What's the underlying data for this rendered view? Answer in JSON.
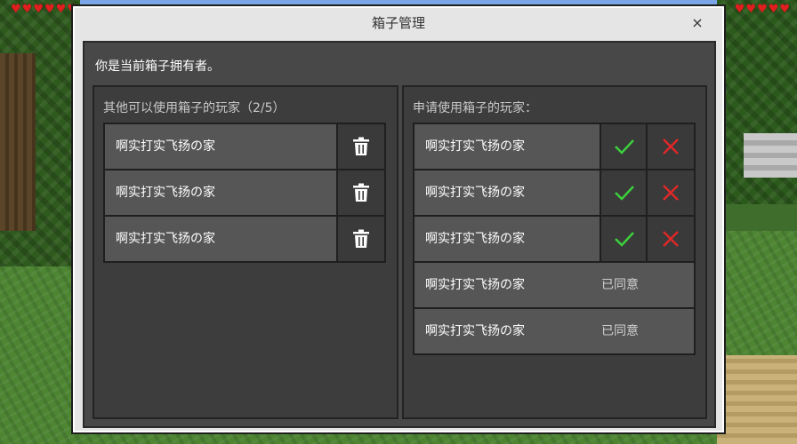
{
  "dialog": {
    "title": "箱子管理",
    "close_label": "×",
    "owner_text": "你是当前箱子拥有者。"
  },
  "left_panel": {
    "title": "其他可以使用箱子的玩家（2/5）",
    "players": [
      {
        "name": "啊实打实飞扬の家"
      },
      {
        "name": "啊实打实飞扬の家"
      },
      {
        "name": "啊实打实飞扬の家"
      }
    ]
  },
  "right_panel": {
    "title": "申请使用箱子的玩家：",
    "requests": [
      {
        "name": "啊实打实飞扬の家",
        "status": ""
      },
      {
        "name": "啊实打实飞扬の家",
        "status": ""
      },
      {
        "name": "啊实打实飞扬の家",
        "status": ""
      },
      {
        "name": "啊实打实飞扬の家",
        "status": "已同意"
      },
      {
        "name": "啊实打实飞扬の家",
        "status": "已同意"
      }
    ]
  },
  "icons": {
    "trash": "trash-icon",
    "accept": "check-icon",
    "reject": "x-icon",
    "heart": "heart-icon"
  },
  "colors": {
    "accept": "#3cd23c",
    "reject": "#e02828",
    "heart": "#e01f1f"
  }
}
